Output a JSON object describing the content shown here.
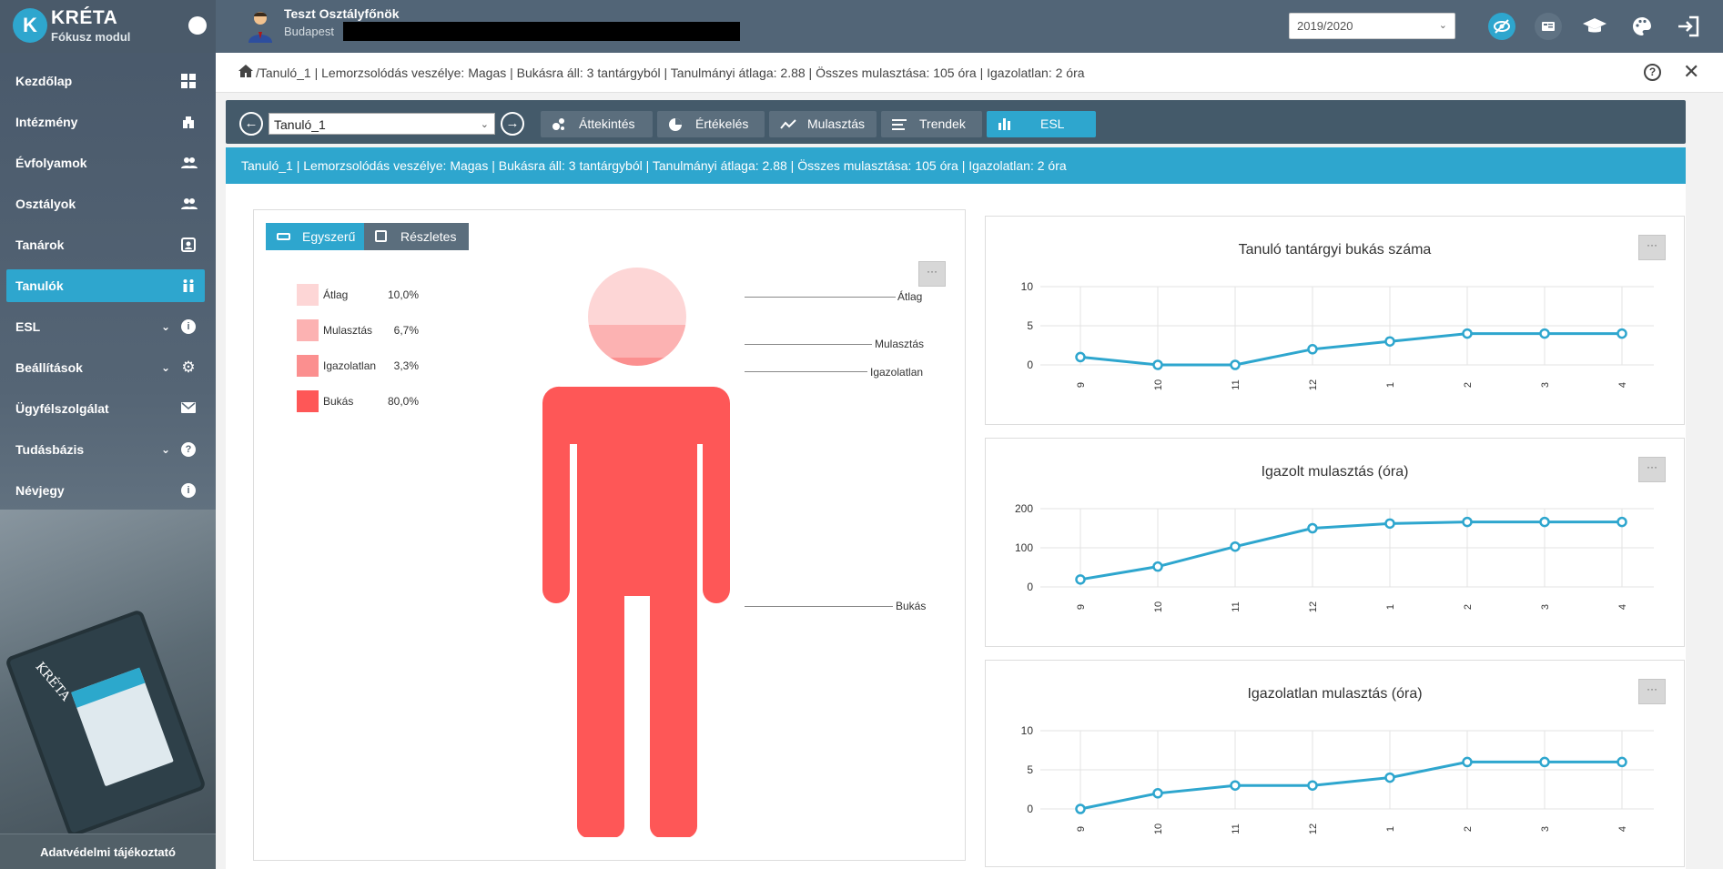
{
  "app": {
    "name": "KRÉTA",
    "module": "Fókusz modul"
  },
  "sidebar": {
    "items": [
      {
        "label": "Kezdőlap",
        "icon": "dashboard-icon"
      },
      {
        "label": "Intézmény",
        "icon": "building-icon"
      },
      {
        "label": "Évfolyamok",
        "icon": "people-icon"
      },
      {
        "label": "Osztályok",
        "icon": "people-icon"
      },
      {
        "label": "Tanárok",
        "icon": "contact-card-icon"
      },
      {
        "label": "Tanulók",
        "icon": "students-icon",
        "active": true
      },
      {
        "label": "ESL",
        "icon": "info-icon",
        "expandable": true
      },
      {
        "label": "Beállítások",
        "icon": "gear-icon",
        "expandable": true
      },
      {
        "label": "Ügyfélszolgálat",
        "icon": "mail-icon"
      },
      {
        "label": "Tudásbázis",
        "icon": "question-icon",
        "expandable": true
      },
      {
        "label": "Névjegy",
        "icon": "info-icon"
      }
    ],
    "privacy_label": "Adatvédelmi tájékoztató"
  },
  "header": {
    "user_name": "Teszt Osztályfőnök",
    "user_location": "Budapest",
    "school_year": "2019/2020"
  },
  "breadcrumb": {
    "text": "/Tanuló_1 | Lemorzsolódás veszélye: Magas | Bukásra áll: 3 tantárgyból | Tanulmányi átlaga: 2.88 | Összes mulasztása: 105 óra | Igazolatlan: 2 óra"
  },
  "toolbar": {
    "student_select": "Tanuló_1",
    "buttons": [
      {
        "label": "Áttekintés",
        "icon": "bubbles-icon"
      },
      {
        "label": "Értékelés",
        "icon": "pie-icon"
      },
      {
        "label": "Mulasztás",
        "icon": "trend-icon"
      },
      {
        "label": "Trendek",
        "icon": "lines-icon"
      },
      {
        "label": "ESL",
        "icon": "bar-chart-icon",
        "active": true
      }
    ]
  },
  "infobar": {
    "text": "Tanuló_1 | Lemorzsolódás veszélye: Magas | Bukásra áll: 3 tantárgyból | Tanulmányi átlaga: 2.88 | Összes mulasztása: 105 óra | Igazolatlan: 2 óra"
  },
  "figure": {
    "view_simple": "Egyszerű",
    "view_detailed": "Részletes",
    "legend": [
      {
        "label": "Átlag",
        "value": "10,0%",
        "color": "#fdd6d6"
      },
      {
        "label": "Mulasztás",
        "value": "6,7%",
        "color": "#fcb2b2"
      },
      {
        "label": "Igazolatlan",
        "value": "3,3%",
        "color": "#fb8f8f"
      },
      {
        "label": "Bukás",
        "value": "80,0%",
        "color": "#fe5757"
      }
    ],
    "callouts": [
      "Átlag",
      "Mulasztás",
      "Igazolatlan",
      "Bukás"
    ],
    "menu": "···"
  },
  "chart_data": [
    {
      "type": "line",
      "title": "Tanuló tantárgyi bukás száma",
      "categories": [
        "9",
        "10",
        "11",
        "12",
        "1",
        "2",
        "3",
        "4"
      ],
      "values": [
        1,
        0,
        0,
        2,
        3,
        4,
        4,
        4
      ],
      "ylim": [
        0,
        10
      ],
      "yticks": [
        0,
        5,
        10
      ],
      "color": "#2ea6ce",
      "grid": true
    },
    {
      "type": "line",
      "title": "Igazolt mulasztás (óra)",
      "categories": [
        "9",
        "10",
        "11",
        "12",
        "1",
        "2",
        "3",
        "4"
      ],
      "values": [
        19,
        52,
        103,
        150,
        162,
        166,
        166,
        166
      ],
      "ylim": [
        0,
        200
      ],
      "yticks": [
        0,
        100,
        200
      ],
      "color": "#2ea6ce",
      "grid": true
    },
    {
      "type": "line",
      "title": "Igazolatlan mulasztás (óra)",
      "categories": [
        "9",
        "10",
        "11",
        "12",
        "1",
        "2",
        "3",
        "4"
      ],
      "values": [
        0,
        2,
        3,
        3,
        4,
        6,
        6,
        6
      ],
      "ylim": [
        0,
        10
      ],
      "yticks": [
        0,
        5,
        10
      ],
      "color": "#2ea6ce",
      "grid": true
    }
  ]
}
